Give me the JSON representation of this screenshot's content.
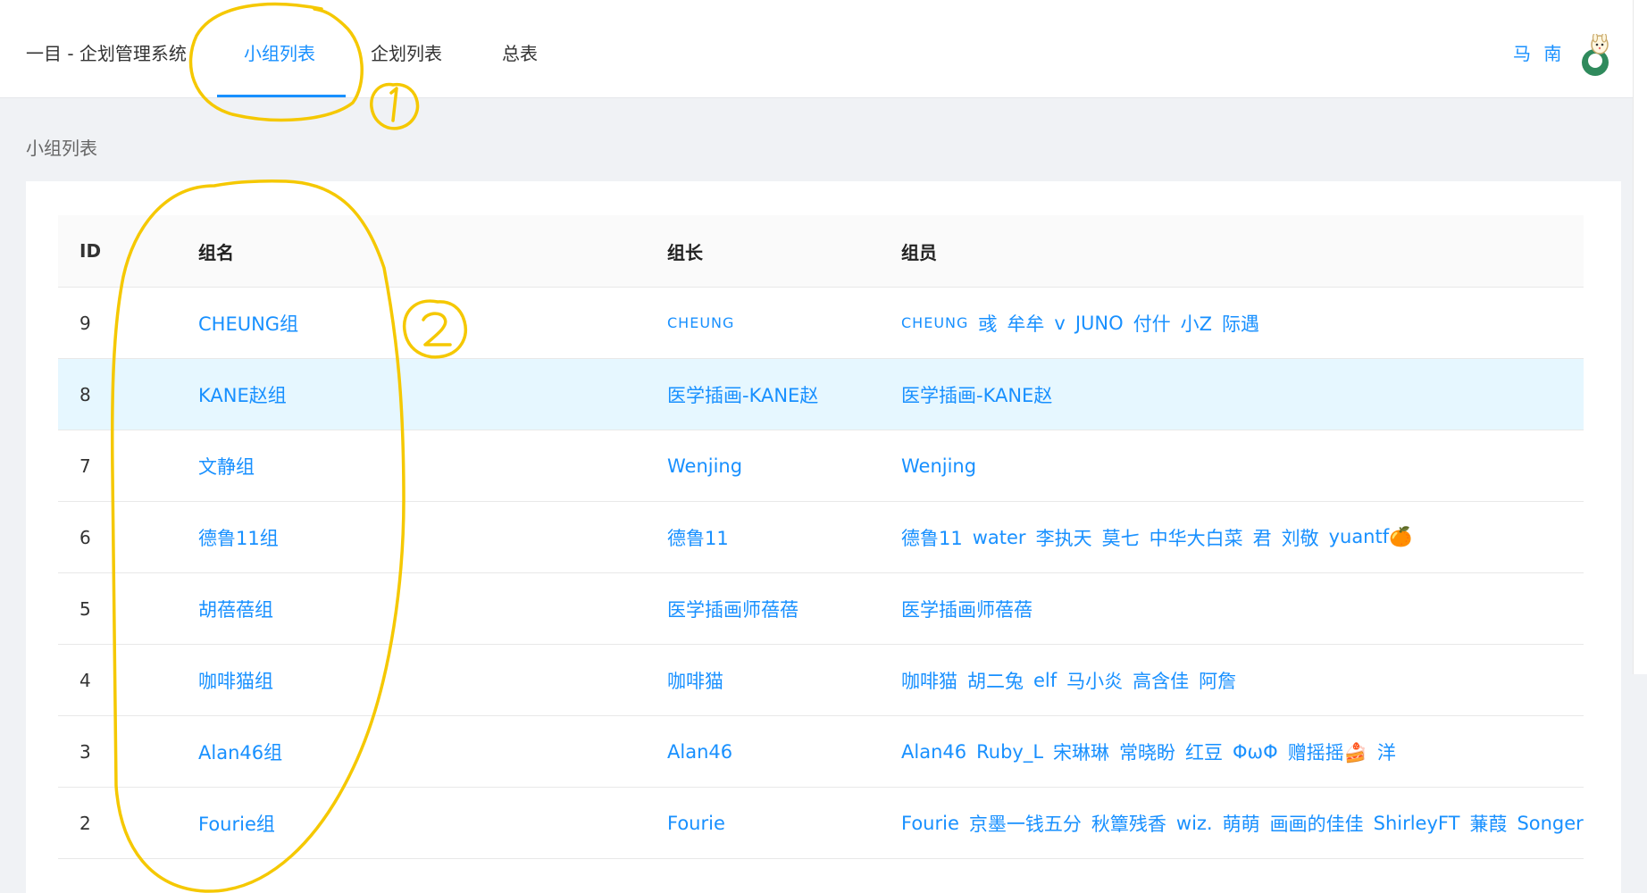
{
  "header": {
    "brand": "一目 - 企划管理系统",
    "tabs": [
      {
        "label": "小组列表",
        "active": true
      },
      {
        "label": "企划列表",
        "active": false
      },
      {
        "label": "总表",
        "active": false
      }
    ],
    "username": "马 南"
  },
  "page": {
    "title": "小组列表"
  },
  "table": {
    "columns": [
      "ID",
      "组名",
      "组长",
      "组员"
    ],
    "rows": [
      {
        "id": "9",
        "name": "CHEUNG组",
        "leader": "CHEUNG",
        "members": [
          "CHEUNG",
          "彧",
          "牟牟",
          "v",
          "JUNO",
          "付什",
          "小Z",
          "际遇"
        ]
      },
      {
        "id": "8",
        "name": "KANE赵组",
        "leader": "医学插画-KANE赵",
        "members": [
          "医学插画-KANE赵"
        ]
      },
      {
        "id": "7",
        "name": "文静组",
        "leader": "Wenjing",
        "members": [
          "Wenjing"
        ]
      },
      {
        "id": "6",
        "name": "德鲁11组",
        "leader": "德鲁11",
        "members": [
          "德鲁11",
          "water",
          "李执天",
          "莫七",
          "中华大白菜",
          "君",
          "刘敬",
          "yuantf🍊"
        ]
      },
      {
        "id": "5",
        "name": "胡蓓蓓组",
        "leader": "医学插画师蓓蓓",
        "members": [
          "医学插画师蓓蓓"
        ]
      },
      {
        "id": "4",
        "name": "咖啡猫组",
        "leader": "咖啡猫",
        "members": [
          "咖啡猫",
          "胡二兔",
          "elf",
          "马小炎",
          "高含佳",
          "阿詹"
        ]
      },
      {
        "id": "3",
        "name": "Alan46组",
        "leader": "Alan46",
        "members": [
          "Alan46",
          "Ruby_L",
          "宋琳琳",
          "常晓盼",
          "红豆",
          "ΦωΦ",
          "赠摇摇🍰",
          "洋"
        ]
      },
      {
        "id": "2",
        "name": "Fourie组",
        "leader": "Fourie",
        "members": [
          "Fourie",
          "京墨一钱五分",
          "秋簟残香",
          "wiz.",
          "萌萌",
          "画画的佳佳",
          "ShirleyFT",
          "蒹葭",
          "Songer"
        ]
      }
    ]
  },
  "annotations": {
    "labels": [
      "1",
      "2"
    ],
    "color": "#f5c800"
  },
  "colors": {
    "accent": "#1890ff",
    "highlight_row": "#e6f7ff",
    "background": "#f0f2f5"
  }
}
